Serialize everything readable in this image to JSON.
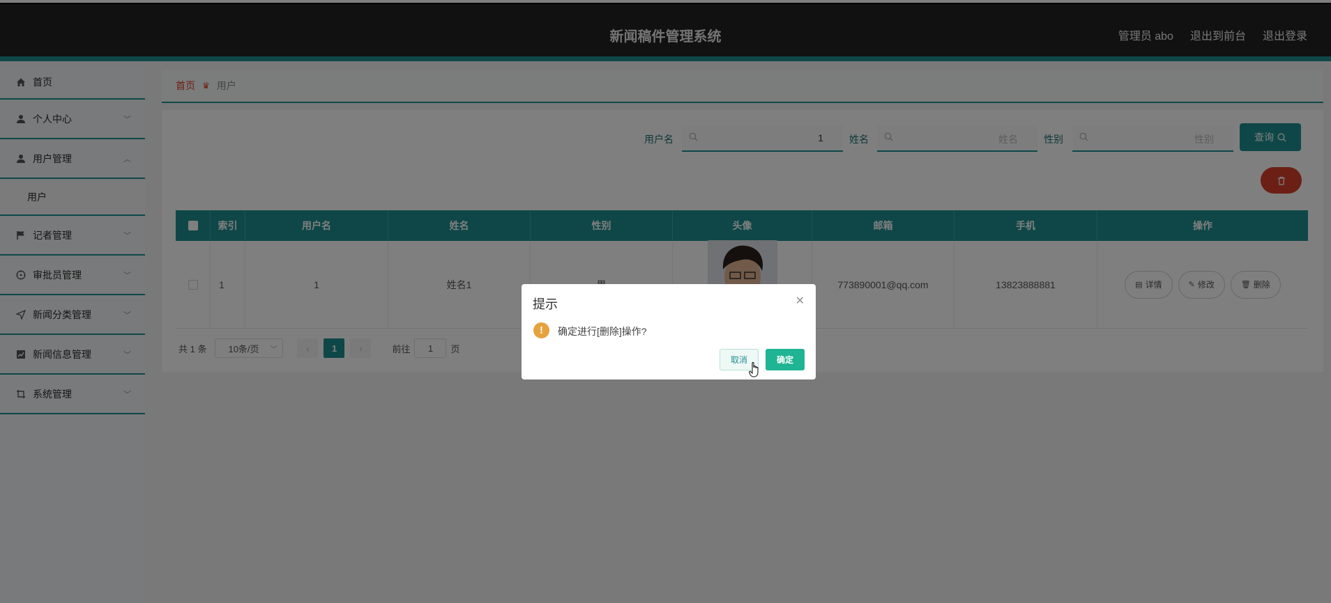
{
  "header": {
    "title": "新闻稿件管理系统",
    "admin_label": "管理员 abo",
    "front_link": "退出到前台",
    "logout_link": "退出登录"
  },
  "sidebar": {
    "items": [
      {
        "label": "首页",
        "icon": "home-icon"
      },
      {
        "label": "个人中心",
        "icon": "user-icon"
      },
      {
        "label": "用户管理",
        "icon": "user-icon",
        "expanded": true,
        "children": [
          "用户"
        ]
      },
      {
        "label": "记者管理",
        "icon": "flag-icon"
      },
      {
        "label": "审批员管理",
        "icon": "compass-icon"
      },
      {
        "label": "新闻分类管理",
        "icon": "send-icon"
      },
      {
        "label": "新闻信息管理",
        "icon": "chart-icon"
      },
      {
        "label": "系统管理",
        "icon": "crop-icon"
      }
    ]
  },
  "breadcrumb": {
    "home": "首页",
    "current": "用户"
  },
  "search": {
    "username_label": "用户名",
    "username_value": "1",
    "name_label": "姓名",
    "name_placeholder": "姓名",
    "gender_label": "性别",
    "gender_placeholder": "性别",
    "query_button": "查询"
  },
  "table": {
    "columns": [
      "索引",
      "用户名",
      "姓名",
      "性别",
      "头像",
      "邮箱",
      "手机",
      "操作"
    ],
    "rows": [
      {
        "index": "1",
        "username": "1",
        "name": "姓名1",
        "gender": "男",
        "email": "773890001@qq.com",
        "phone": "13823888881"
      }
    ],
    "actions": {
      "detail": "详情",
      "edit": "修改",
      "delete": "删除"
    }
  },
  "pagination": {
    "total": "共 1 条",
    "page_size": "10条/页",
    "current_page": "1",
    "goto_prefix": "前往",
    "goto_value": "1",
    "goto_suffix": "页"
  },
  "dialog": {
    "title": "提示",
    "message": "确定进行[删除]操作?",
    "cancel": "取消",
    "confirm": "确定"
  },
  "colors": {
    "primary": "#1f8f91",
    "danger": "#d9412a",
    "warning": "#e6a23c",
    "header_bg": "#232323"
  }
}
